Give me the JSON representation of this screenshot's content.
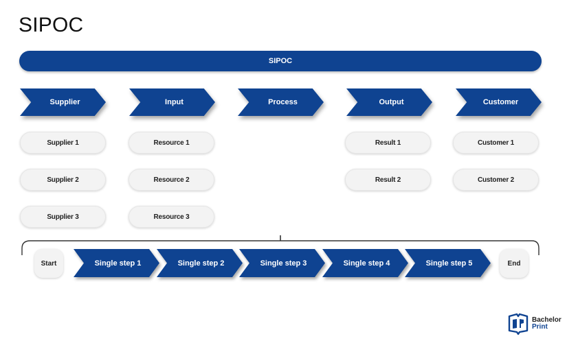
{
  "page": {
    "title": "SIPOC"
  },
  "banner": {
    "label": "SIPOC"
  },
  "colors": {
    "primary": "#0f4391",
    "pill_bg": "#f3f3f3",
    "text_dark": "#222222"
  },
  "columns": [
    {
      "header": "Supplier",
      "items": [
        "Supplier 1",
        "Supplier 2",
        "Supplier 3"
      ]
    },
    {
      "header": "Input",
      "items": [
        "Resource 1",
        "Resource 2",
        "Resource 3"
      ]
    },
    {
      "header": "Process",
      "items": []
    },
    {
      "header": "Output",
      "items": [
        "Result 1",
        "Result 2"
      ]
    },
    {
      "header": "Customer",
      "items": [
        "Customer 1",
        "Customer 2"
      ]
    }
  ],
  "process_flow": {
    "start": "Start",
    "steps": [
      "Single step 1",
      "Single step 2",
      "Single step 3",
      "Single step 4",
      "Single step 5"
    ],
    "end": "End"
  },
  "logo": {
    "line1": "Bachelor",
    "line2": "Print",
    "icon": "open-book-icon"
  }
}
